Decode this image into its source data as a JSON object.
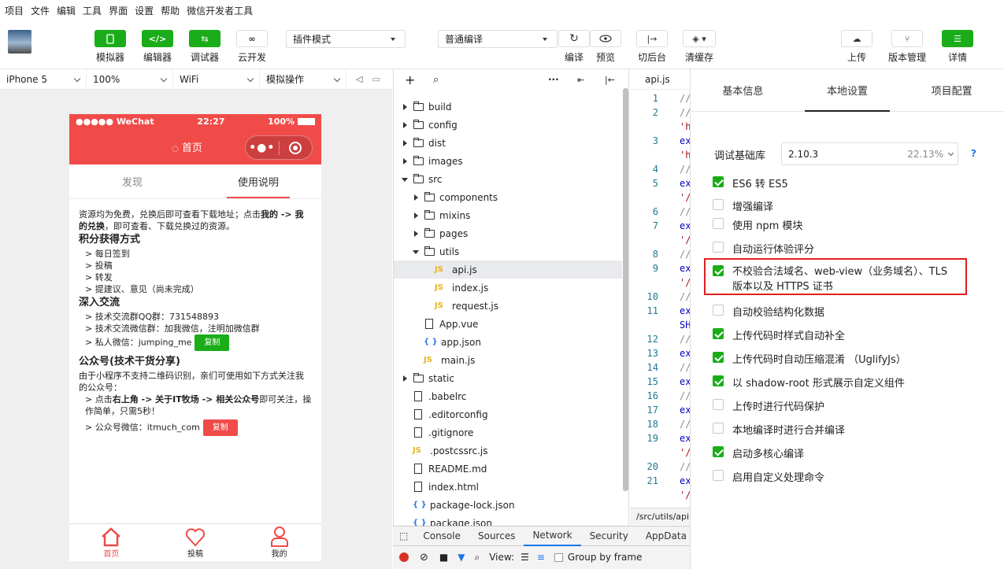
{
  "menu": [
    "项目",
    "文件",
    "编辑",
    "工具",
    "界面",
    "设置",
    "帮助",
    "微信开发者工具"
  ],
  "toolbar": {
    "simulator_label": "模拟器",
    "editor_label": "编辑器",
    "debugger_label": "调试器",
    "cloud_label": "云开发",
    "mode_select": "插件模式",
    "compile_select": "普通编译",
    "compile_label": "编译",
    "preview_label": "预览",
    "background_label": "切后台",
    "clear_cache_label": "清缓存",
    "upload_label": "上传",
    "version_label": "版本管理",
    "details_label": "详情"
  },
  "device_bar": {
    "device": "iPhone 5",
    "zoom": "100%",
    "network": "WiFi",
    "operation": "模拟操作"
  },
  "phone": {
    "status_left": "●●●●● WeChat",
    "status_time": "22:27",
    "status_battery": "100%",
    "nav_title": "首页",
    "tabs": [
      "发现",
      "使用说明"
    ],
    "intro_text": "资源均为免费，兑换后即可查看下载地址；点击",
    "intro_bold1": "我的 -> 我的兑换",
    "intro_rest": "，即可查看、下载兑换过的资源。",
    "section1_title": "积分获得方式",
    "section1_items": [
      "每日签到",
      "投稿",
      "转发",
      "提建议、意见（尚未完成）"
    ],
    "section2_title": "深入交流",
    "section2_items": [
      "技术交流群QQ群：731548893",
      "技术交流微信群：加我微信，注明加微信群",
      "私人微信：jumping_me"
    ],
    "copy_label": "复制",
    "section3_title": "公众号(技术干货分享)",
    "section3_intro": "由于小程序不支持二维码识别，亲们可使用如下方式关注我的公众号：",
    "section3_item1_a": "点击",
    "section3_item1_b": "右上角 -> 关于IT牧场 -> 相关公众号",
    "section3_item1_c": "即可关注，操作简单，只需5秒！",
    "section3_item2": "公众号微信：itmuch_com",
    "tabbar": [
      "首页",
      "投稿",
      "我的"
    ],
    "colors": {
      "primary": "#f04b49",
      "copy_green": "#1aad19",
      "copy_red": "#f04b49"
    }
  },
  "filetree": {
    "items": [
      {
        "name": "build",
        "type": "folder",
        "state": "collapsed",
        "level": 0
      },
      {
        "name": "config",
        "type": "folder",
        "state": "collapsed",
        "level": 0
      },
      {
        "name": "dist",
        "type": "folder",
        "state": "collapsed",
        "level": 0
      },
      {
        "name": "images",
        "type": "folder",
        "state": "collapsed",
        "level": 0
      },
      {
        "name": "src",
        "type": "folder",
        "state": "expanded",
        "level": 0
      },
      {
        "name": "components",
        "type": "folder",
        "state": "collapsed",
        "level": 1
      },
      {
        "name": "mixins",
        "type": "folder",
        "state": "collapsed",
        "level": 1
      },
      {
        "name": "pages",
        "type": "folder",
        "state": "collapsed",
        "level": 1
      },
      {
        "name": "utils",
        "type": "folder",
        "state": "expanded",
        "level": 1
      },
      {
        "name": "api.js",
        "type": "js",
        "level": 2,
        "selected": true
      },
      {
        "name": "index.js",
        "type": "js",
        "level": 2
      },
      {
        "name": "request.js",
        "type": "js",
        "level": 2
      },
      {
        "name": "App.vue",
        "type": "file",
        "level": 1
      },
      {
        "name": "app.json",
        "type": "json",
        "level": 1
      },
      {
        "name": "main.js",
        "type": "js",
        "level": 1
      },
      {
        "name": "static",
        "type": "folder",
        "state": "collapsed",
        "level": 0
      },
      {
        "name": ".babelrc",
        "type": "file",
        "level": 0
      },
      {
        "name": ".editorconfig",
        "type": "file",
        "level": 0
      },
      {
        "name": ".gitignore",
        "type": "file",
        "level": 0
      },
      {
        "name": ".postcssrc.js",
        "type": "js",
        "level": 0
      },
      {
        "name": "README.md",
        "type": "file",
        "level": 0
      },
      {
        "name": "index.html",
        "type": "file",
        "level": 0
      },
      {
        "name": "package-lock.json",
        "type": "json",
        "level": 0
      },
      {
        "name": "package.json",
        "type": "json",
        "level": 0
      }
    ]
  },
  "editor": {
    "tab_name": "api.js",
    "footer_path": "/src/utils/api.",
    "lines": [
      {
        "n": "1",
        "t": "//"
      },
      {
        "n": "2",
        "t": "//"
      },
      {
        "n": "",
        "t": "'h"
      },
      {
        "n": "3",
        "t": "ex"
      },
      {
        "n": "",
        "t": "'h"
      },
      {
        "n": "4",
        "t": "//"
      },
      {
        "n": "5",
        "t": "ex"
      },
      {
        "n": "",
        "t": "'/"
      },
      {
        "n": "6",
        "t": "//"
      },
      {
        "n": "7",
        "t": "ex"
      },
      {
        "n": "",
        "t": "'/"
      },
      {
        "n": "8",
        "t": "//"
      },
      {
        "n": "9",
        "t": "ex"
      },
      {
        "n": "",
        "t": "'/"
      },
      {
        "n": "10",
        "t": "//"
      },
      {
        "n": "11",
        "t": "ex"
      },
      {
        "n": "",
        "t": "SH"
      },
      {
        "n": "12",
        "t": "//"
      },
      {
        "n": "13",
        "t": "ex"
      },
      {
        "n": "14",
        "t": "//"
      },
      {
        "n": "15",
        "t": "ex"
      },
      {
        "n": "16",
        "t": "//"
      },
      {
        "n": "17",
        "t": "ex"
      },
      {
        "n": "18",
        "t": "//"
      },
      {
        "n": "19",
        "t": "ex"
      },
      {
        "n": "",
        "t": "'/"
      },
      {
        "n": "20",
        "t": "//"
      },
      {
        "n": "21",
        "t": "ex"
      },
      {
        "n": "",
        "t": "'/"
      }
    ]
  },
  "devtools": {
    "tabs": [
      "Console",
      "Sources",
      "Network",
      "Security",
      "AppData"
    ],
    "active_tab": "Network",
    "view_label": "View:",
    "group_by_frame": "Group by frame"
  },
  "settings": {
    "tabs": [
      "基本信息",
      "本地设置",
      "项目配置"
    ],
    "active_tab": "本地设置",
    "lib_label": "调试基础库",
    "lib_version": "2.10.3",
    "lib_percent": "22.13%",
    "help_icon": "?",
    "options": [
      {
        "label": "ES6 转 ES5",
        "checked": true
      },
      {
        "label": "增强编译",
        "checked": false
      },
      {
        "label": "使用 npm 模块",
        "checked": false
      },
      {
        "label": "自动运行体验评分",
        "checked": false
      },
      {
        "label": "不校验合法域名、web-view（业务域名）、TLS 版本以及 HTTPS 证书",
        "checked": true,
        "highlighted": true
      },
      {
        "label": "自动校验结构化数据",
        "checked": false
      },
      {
        "label": "上传代码时样式自动补全",
        "checked": true
      },
      {
        "label": "上传代码时自动压缩混淆 （UglifyJs）",
        "checked": true
      },
      {
        "label": "以 shadow-root 形式展示自定义组件",
        "checked": true
      },
      {
        "label": "上传时进行代码保护",
        "checked": false
      },
      {
        "label": "本地编译时进行合并编译",
        "checked": false
      },
      {
        "label": "启动多核心编译",
        "checked": true
      },
      {
        "label": "启用自定义处理命令",
        "checked": false
      }
    ]
  }
}
